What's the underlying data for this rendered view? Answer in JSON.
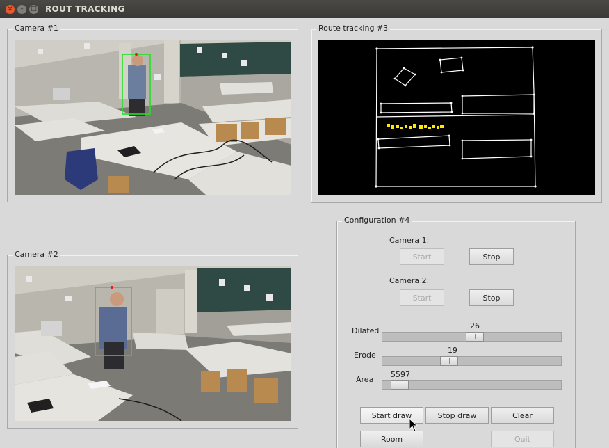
{
  "window": {
    "title": "ROUT TRACKING",
    "close_glyph": "×",
    "min_glyph": "–",
    "max_glyph": "□"
  },
  "camera1": {
    "label": "Camera #1"
  },
  "camera2": {
    "label": "Camera #2"
  },
  "route": {
    "label": "Route tracking #3",
    "track_color": "#ffea00"
  },
  "config": {
    "label": "Configuration #4",
    "camera1_label": "Camera 1:",
    "camera2_label": "Camera 2:",
    "start_label": "Start",
    "stop_label": "Stop",
    "sliders": [
      {
        "name": "Dilated",
        "value": "26",
        "fraction": 0.52
      },
      {
        "name": "Erode",
        "value": "19",
        "fraction": 0.36
      },
      {
        "name": "Area",
        "value": "5597",
        "fraction": 0.05
      }
    ],
    "buttons": {
      "start_draw": "Start draw",
      "stop_draw": "Stop draw",
      "clear": "Clear",
      "room": "Room",
      "quit": "Quit"
    }
  },
  "colors": {
    "titlebar": "#3c3b37",
    "close": "#e8582f",
    "detection": "#22e022",
    "background": "#d9d9d9"
  },
  "icons": [
    "close-icon",
    "minimize-icon",
    "maximize-icon",
    "mouse-cursor-icon"
  ]
}
